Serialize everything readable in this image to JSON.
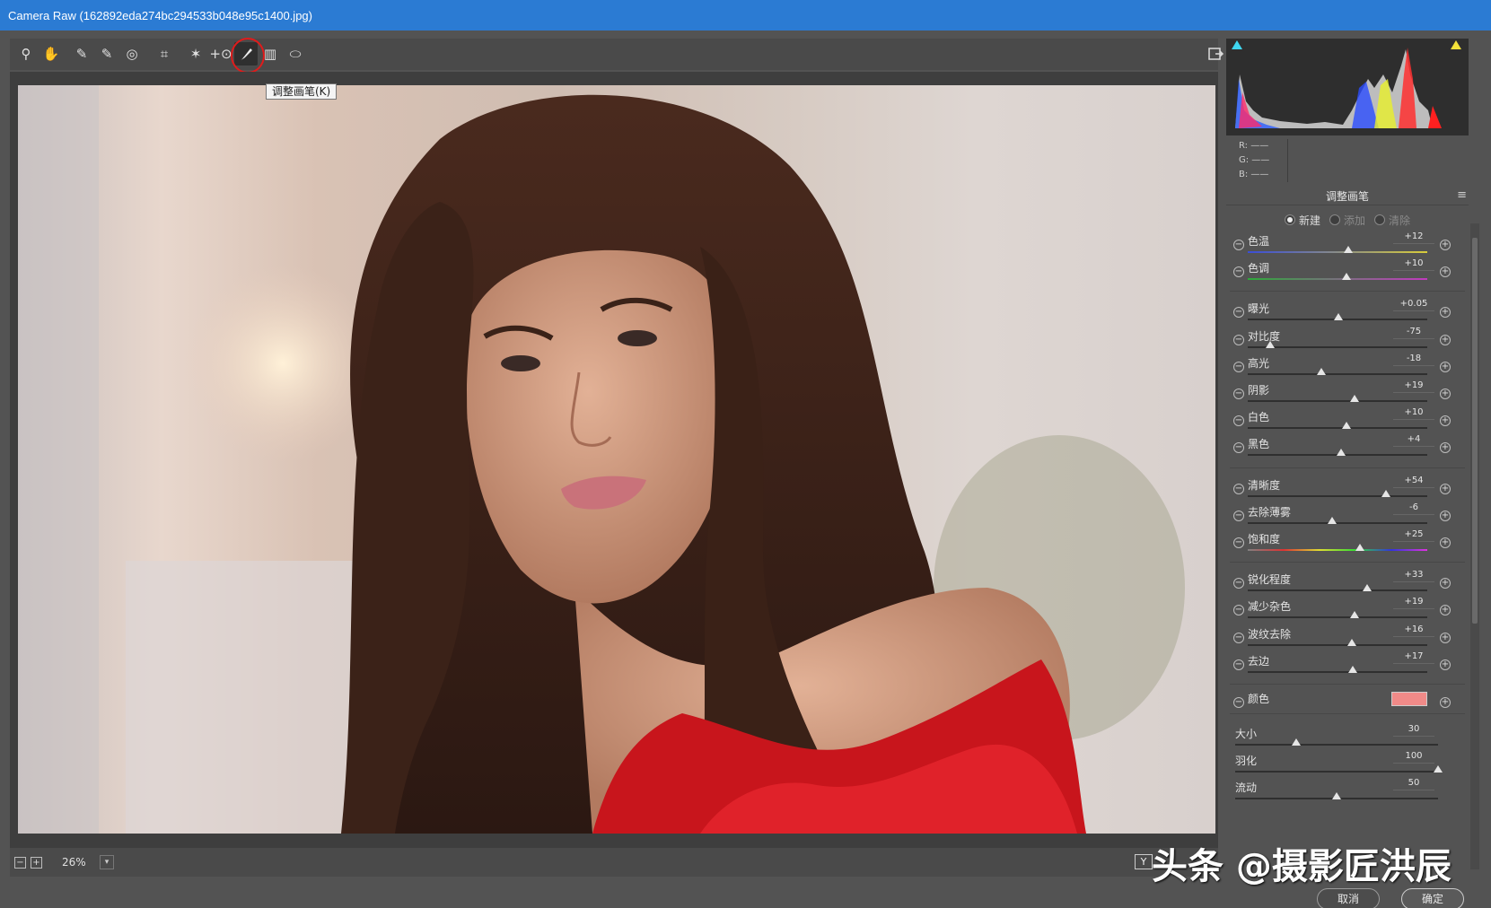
{
  "window": {
    "title": "Camera Raw (162892eda274bc294533b048e95c1400.jpg)"
  },
  "toolbar": {
    "tools": [
      {
        "name": "zoom-tool",
        "glyph": "⚲"
      },
      {
        "name": "hand-tool",
        "glyph": "✋"
      },
      {
        "name": "white-balance-tool",
        "glyph": "✎"
      },
      {
        "name": "color-sampler-tool",
        "glyph": "✎"
      },
      {
        "name": "targeted-adjustment-tool",
        "glyph": "◎"
      },
      {
        "name": "crop-tool",
        "glyph": "⌗"
      },
      {
        "name": "spot-removal-tool",
        "glyph": "✶"
      },
      {
        "name": "red-eye-tool",
        "glyph": "+⊙"
      },
      {
        "name": "adjustment-brush-tool",
        "glyph": "brush"
      },
      {
        "name": "graduated-filter-tool",
        "glyph": "▥"
      },
      {
        "name": "radial-filter-tool",
        "glyph": "⬭"
      }
    ],
    "active_tool": "adjustment-brush-tool",
    "tooltip": "调整画笔(K)"
  },
  "histogram": {
    "r": "R:  ——",
    "g": "G:  ——",
    "b": "B:  ——"
  },
  "panel": {
    "title": "调整画笔",
    "modes": [
      {
        "label": "新建",
        "selected": true
      },
      {
        "label": "添加",
        "selected": false
      },
      {
        "label": "清除",
        "selected": false
      }
    ],
    "groups": [
      [
        {
          "label": "色温",
          "value": "+12",
          "pos": 0.56,
          "track": "temp"
        },
        {
          "label": "色调",
          "value": "+10",
          "pos": 0.55,
          "track": "tint"
        }
      ],
      [
        {
          "label": "曝光",
          "value": "+0.05",
          "pos": 0.505,
          "track": "plain"
        },
        {
          "label": "对比度",
          "value": "-75",
          "pos": 0.125,
          "track": "plain"
        },
        {
          "label": "高光",
          "value": "-18",
          "pos": 0.41,
          "track": "plain"
        },
        {
          "label": "阴影",
          "value": "+19",
          "pos": 0.595,
          "track": "plain"
        },
        {
          "label": "白色",
          "value": "+10",
          "pos": 0.55,
          "track": "plain"
        },
        {
          "label": "黑色",
          "value": "+4",
          "pos": 0.52,
          "track": "plain"
        }
      ],
      [
        {
          "label": "清晰度",
          "value": "+54",
          "pos": 0.77,
          "track": "plain"
        },
        {
          "label": "去除薄雾",
          "value": "-6",
          "pos": 0.47,
          "track": "plain"
        },
        {
          "label": "饱和度",
          "value": "+25",
          "pos": 0.625,
          "track": "sat"
        }
      ],
      [
        {
          "label": "锐化程度",
          "value": "+33",
          "pos": 0.665,
          "track": "plain"
        },
        {
          "label": "减少杂色",
          "value": "+19",
          "pos": 0.595,
          "track": "plain"
        },
        {
          "label": "波纹去除",
          "value": "+16",
          "pos": 0.58,
          "track": "plain"
        },
        {
          "label": "去边",
          "value": "+17",
          "pos": 0.585,
          "track": "plain"
        }
      ]
    ],
    "color": {
      "label": "颜色",
      "swatch": "#f08a88"
    },
    "brush": [
      {
        "label": "大小",
        "value": "30",
        "pos": 0.3
      },
      {
        "label": "羽化",
        "value": "100",
        "pos": 1.0
      },
      {
        "label": "流动",
        "value": "50",
        "pos": 0.5
      }
    ]
  },
  "status": {
    "zoom": "26%",
    "yview": "Y"
  },
  "watermark": "头条 @摄影匠洪辰",
  "buttons": {
    "cancel": "取消",
    "ok": "确定"
  }
}
